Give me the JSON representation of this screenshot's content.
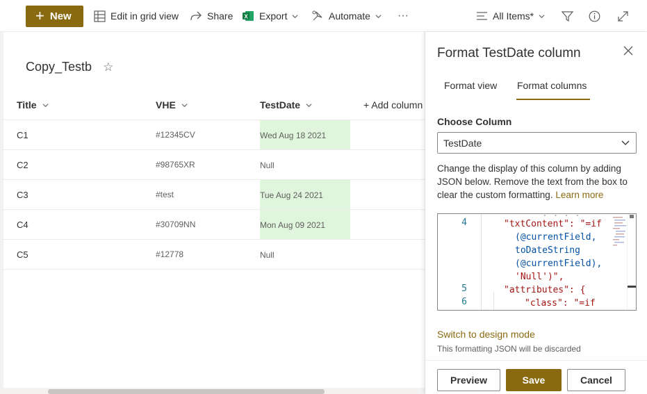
{
  "commandbar": {
    "new_label": "New",
    "edit_grid_label": "Edit in grid view",
    "share_label": "Share",
    "export_label": "Export",
    "automate_label": "Automate",
    "more_label": "···",
    "view_label": "All Items*"
  },
  "list": {
    "title": "Copy_Testb",
    "columns": [
      "Title",
      "VHE",
      "TestDate",
      "+ Add column"
    ],
    "rows": [
      {
        "title": "C1",
        "vhe": "#12345CV",
        "date": "Wed Aug 18 2021",
        "highlight": true
      },
      {
        "title": "C2",
        "vhe": "#98765XR",
        "date": "Null",
        "highlight": false
      },
      {
        "title": "C3",
        "vhe": "#test",
        "date": "Tue Aug 24 2021",
        "highlight": true
      },
      {
        "title": "C4",
        "vhe": "#30709NN",
        "date": "Mon Aug 09 2021",
        "highlight": true
      },
      {
        "title": "C5",
        "vhe": "#12778",
        "date": "Null",
        "highlight": false
      }
    ]
  },
  "panel": {
    "title": "Format TestDate column",
    "tabs": [
      "Format view",
      "Format columns"
    ],
    "active_tab": "Format columns",
    "choose_label": "Choose Column",
    "selected_column": "TestDate",
    "help_text": "Change the display of this column by adding JSON below. Remove the text from the box to clear the custom formatting.",
    "learn_more": "Learn more",
    "editor": {
      "line_numbers": [
        "4",
        "5",
        "6"
      ],
      "lines": [
        "\"txtContent\": \"=if",
        "(@currentField,",
        "toDateString",
        "(@currentField),",
        "'Null')\",",
        "\"attributes\": {",
        "\"class\": \"=if"
      ]
    },
    "switch_label": "Switch to design mode",
    "discard_note": "This formatting JSON will be discarded",
    "preview_label": "Preview",
    "save_label": "Save",
    "cancel_label": "Cancel"
  },
  "colors": {
    "accent": "#8a6a11",
    "highlight": "#dff6dd"
  }
}
